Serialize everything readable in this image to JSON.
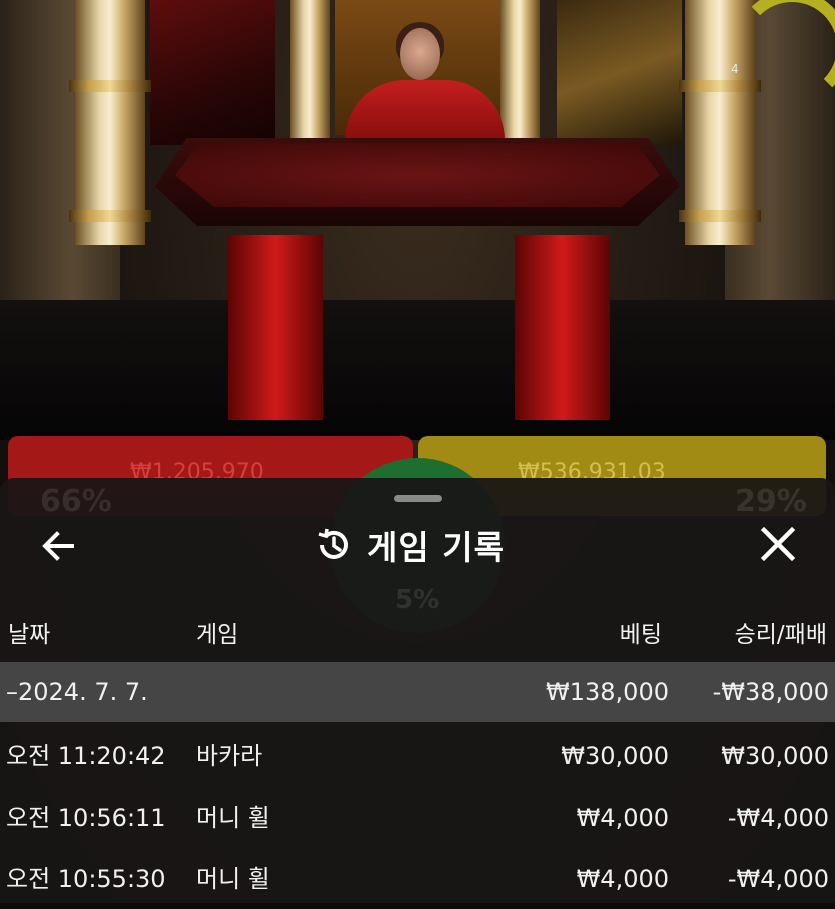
{
  "stream": {
    "countdown": "4"
  },
  "bets": {
    "dragon_total": "₩1,205,970",
    "dragon_pct": "66%",
    "tiger_total": "₩536,931.03",
    "tiger_pct": "29%",
    "tie_pct": "5%"
  },
  "history": {
    "title": "게임 기록",
    "columns": {
      "date": "날짜",
      "game": "게임",
      "bet": "베팅",
      "result": "승리/패배"
    },
    "date_group": {
      "date": "–2024. 7. 7.",
      "bet": "₩138,000",
      "result": "-₩38,000"
    },
    "rows": [
      {
        "time": "오전 11:20:42",
        "game": "바카라",
        "bet": "₩30,000",
        "result": "₩30,000"
      },
      {
        "time": "오전 10:56:11",
        "game": "머니 휠",
        "bet": "₩4,000",
        "result": "-₩4,000"
      },
      {
        "time": "오전 10:55:30",
        "game": "머니 휠",
        "bet": "₩4,000",
        "result": "-₩4,000"
      }
    ]
  },
  "colors": {
    "sheet_bg": "#181615",
    "highlight_row": "#6e6e6e",
    "dragon_red": "#a41818",
    "tiger_gold": "#a28b14",
    "timer_arc": "#b5b022"
  },
  "icons": [
    "back-arrow-icon",
    "history-icon",
    "close-icon"
  ]
}
